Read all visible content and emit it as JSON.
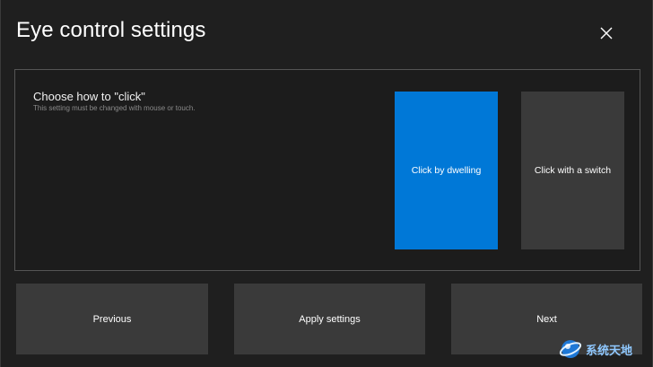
{
  "window": {
    "title": "Eye control settings",
    "close_icon": "close-icon"
  },
  "panel": {
    "heading": "Choose how to \"click\"",
    "hint": "This setting must be changed with mouse or touch.",
    "options": [
      {
        "label": "Click by dwelling",
        "selected": true,
        "color": "#0078d7"
      },
      {
        "label": "Click with a switch",
        "selected": false,
        "color": "#3a3a3a"
      }
    ]
  },
  "footer": {
    "previous_label": "Previous",
    "apply_label": "Apply settings",
    "next_label": "Next"
  },
  "watermark": {
    "text": "系统天地",
    "icon": "globe-logo-icon"
  },
  "colors": {
    "background": "#1f1f1f",
    "accent": "#0078d7",
    "button": "#3a3a3a",
    "border": "#555555"
  }
}
